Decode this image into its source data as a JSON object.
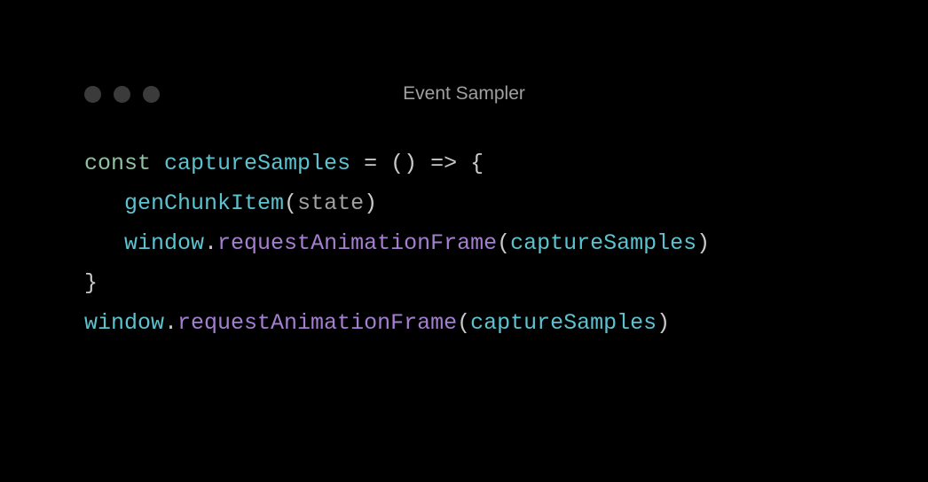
{
  "window": {
    "title": "Event Sampler"
  },
  "code": {
    "const_kw": "const",
    "fn_name": "captureSamples",
    "eq": " = ",
    "arrow_head": "() => {",
    "indent1": "   ",
    "call_genChunkItem": "genChunkItem",
    "lparen": "(",
    "arg_state": "state",
    "rparen": ")",
    "indent2": "   ",
    "obj_window": "window",
    "dot": ".",
    "method_raf": "requestAnimationFrame",
    "ref_captureSamples": "captureSamples",
    "close_brace": "}",
    "obj_window2": "window",
    "method_raf2": "requestAnimationFrame",
    "ref_captureSamples2": "captureSamples"
  }
}
